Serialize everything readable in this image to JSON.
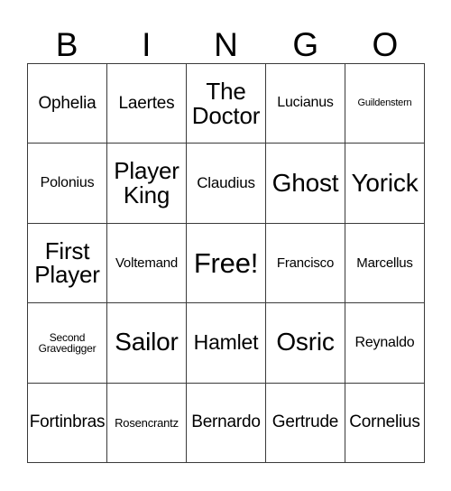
{
  "card": {
    "title_letters": [
      "B",
      "I",
      "N",
      "G",
      "O"
    ],
    "rows": [
      [
        {
          "text": "Ophelia",
          "size": "xl"
        },
        {
          "text": "Laertes",
          "size": "xl"
        },
        {
          "text": "The\nDoctor",
          "size": "h1"
        },
        {
          "text": "Lucianus",
          "size": "ml"
        },
        {
          "text": "Guildenstern",
          "size": "xxs"
        }
      ],
      [
        {
          "text": "Polonius",
          "size": "ml"
        },
        {
          "text": "Player\nKing",
          "size": "h1"
        },
        {
          "text": "Claudius",
          "size": "l"
        },
        {
          "text": "Ghost",
          "size": "h2"
        },
        {
          "text": "Yorick",
          "size": "h2"
        }
      ],
      [
        {
          "text": "First\nPlayer",
          "size": "h1"
        },
        {
          "text": "Voltemand",
          "size": "m"
        },
        {
          "text": "Free!",
          "size": "free"
        },
        {
          "text": "Francisco",
          "size": "m"
        },
        {
          "text": "Marcellus",
          "size": "m"
        }
      ],
      [
        {
          "text": "Second\nGravedigger",
          "size": "xs"
        },
        {
          "text": "Sailor",
          "size": "h2"
        },
        {
          "text": "Hamlet",
          "size": "xxl"
        },
        {
          "text": "Osric",
          "size": "h2"
        },
        {
          "text": "Reynaldo",
          "size": "ml"
        }
      ],
      [
        {
          "text": "Fortinbras",
          "size": "xl"
        },
        {
          "text": "Rosencrantz",
          "size": "s"
        },
        {
          "text": "Bernardo",
          "size": "xl"
        },
        {
          "text": "Gertrude",
          "size": "xl"
        },
        {
          "text": "Cornelius",
          "size": "xl"
        }
      ]
    ]
  }
}
